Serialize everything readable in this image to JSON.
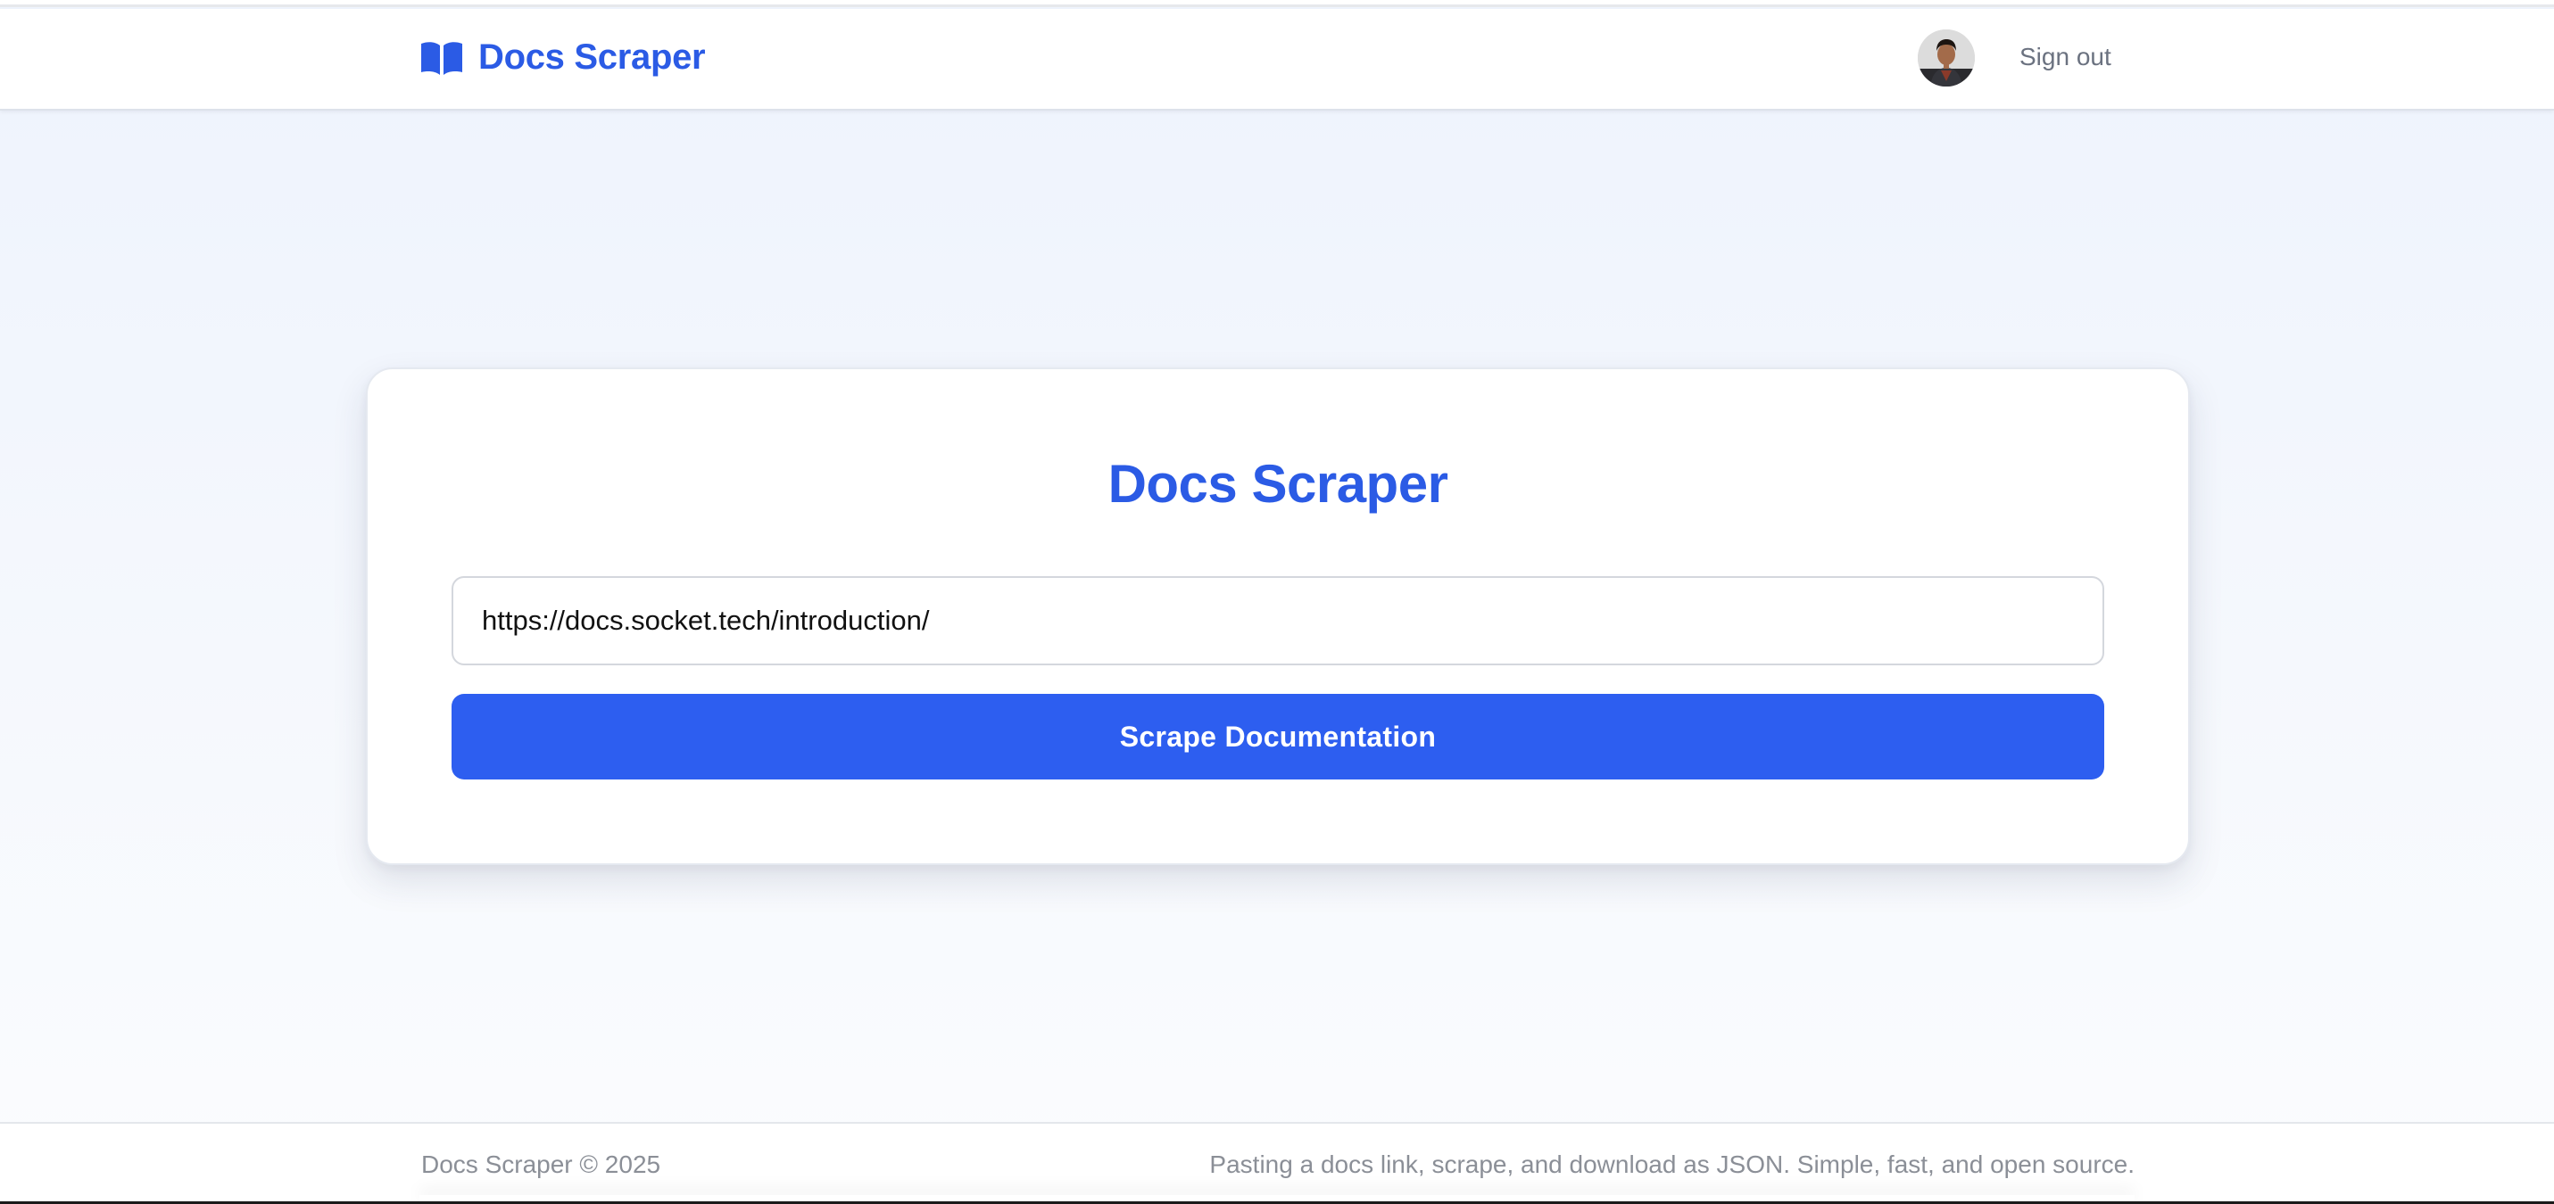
{
  "navbar": {
    "brand_icon": "open-book-icon",
    "brand_name": "Docs Scraper",
    "avatar_icon": "user-avatar",
    "signout_label": "Sign out"
  },
  "main": {
    "title": "Docs Scraper",
    "url_input_value": "https://docs.socket.tech/introduction/",
    "scrape_button_label": "Scrape Documentation"
  },
  "footer": {
    "copyright": "Docs Scraper © 2025",
    "tagline": "Pasting a docs link, scrape, and download as JSON. Simple, fast, and open source."
  },
  "colors": {
    "brand": "#2b5be5",
    "button": "#2d5ef0",
    "muted_text": "#8b8f97"
  }
}
